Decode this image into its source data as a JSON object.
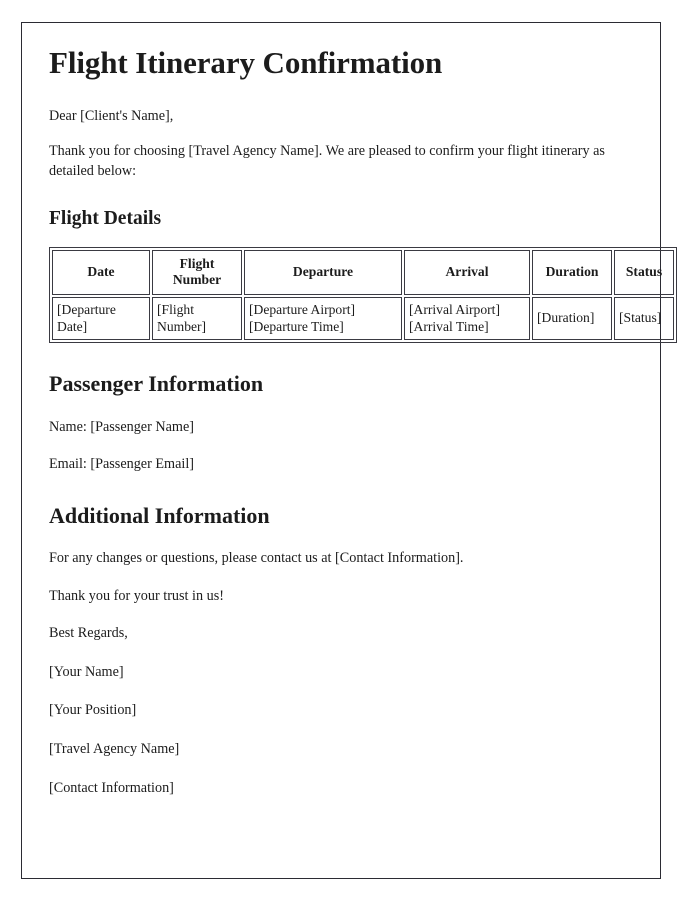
{
  "document": {
    "title": "Flight Itinerary Confirmation",
    "salutation": "Dear [Client's Name],",
    "intro_paragraph": "Thank you for choosing [Travel Agency Name]. We are pleased to confirm your flight itinerary as detailed below:"
  },
  "flight_details": {
    "heading": "Flight Details",
    "columns": [
      "Date",
      "Flight Number",
      "Departure",
      "Arrival",
      "Duration",
      "Status"
    ],
    "rows": [
      {
        "date": "[Departure Date]",
        "flight_number": "[Flight Number]",
        "departure_airport": "[Departure Airport]",
        "departure_time": "[Departure Time]",
        "arrival_airport": "[Arrival Airport]",
        "arrival_time": "[Arrival Time]",
        "duration": "[Duration]",
        "status": "[Status]"
      }
    ]
  },
  "passenger_information": {
    "heading": "Passenger Information",
    "name_line": "Name: [Passenger Name]",
    "email_line": "Email: [Passenger Email]"
  },
  "additional_information": {
    "heading": "Additional Information",
    "contact_line": "For any changes or questions, please contact us at [Contact Information].",
    "thanks_line": "Thank you for your trust in us!",
    "closing": "Best Regards,",
    "signature": [
      "[Your Name]",
      "[Your Position]",
      "[Travel Agency Name]",
      "[Contact Information]"
    ]
  },
  "colors": {
    "page_border": "#2b2b33",
    "table_border": "#3a3a42",
    "text": "#1c1c1c",
    "background": "#ffffff"
  }
}
